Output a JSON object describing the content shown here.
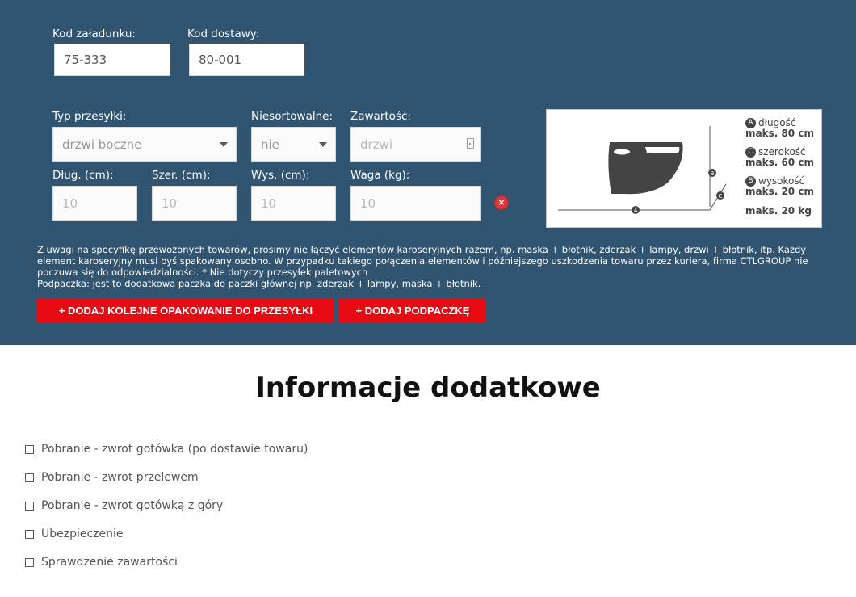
{
  "shipment": {
    "load_code": {
      "label": "Kod załadunku:",
      "value": "75-333"
    },
    "delivery_code": {
      "label": "Kod dostawy:",
      "value": "80-001"
    },
    "type": {
      "label": "Typ przesyłki:",
      "value": "drzwi boczne"
    },
    "unsorted": {
      "label": "Niesortowalne:",
      "value": "nie"
    },
    "contents": {
      "label": "Zawartość:",
      "placeholder": "drzwi"
    },
    "length": {
      "label": "Dług. (cm):",
      "value": "10"
    },
    "width": {
      "label": "Szer. (cm):",
      "value": "10"
    },
    "height": {
      "label": "Wys. (cm):",
      "value": "10"
    },
    "weight": {
      "label": "Waga (kg):",
      "value": "10"
    },
    "remove_label": "×"
  },
  "diagram": {
    "a_letter": "A",
    "a_label": "długość",
    "a_max": "maks. 80 cm",
    "c_letter": "C",
    "c_label": "szerokość",
    "c_max": "maks. 60 cm",
    "b_letter": "B",
    "b_label": "wysokość",
    "b_max": "maks. 20 cm",
    "weight_max": "maks. 20 kg"
  },
  "notice": {
    "line1": "Z uwagi na specyfikę przewożonych towarów, prosimy nie łączyć elementów karoseryjnych razem, np. maska + błotnik, zderzak + lampy, drzwi + błotnik, itp. Każdy element karoseryjny musi byś spakowany osobno. W przypadku takiego połączenia elementów i późniejszego uszkodzenia towaru przez kuriera, firma CTLGROUP nie poczuwa się do odpowiedzialności. * Nie dotyczy przesyłek paletowych",
    "line2": "Podpaczka:  jest  to dodatkowa paczka do paczki głównej np. zderzak +  lampy,  maska + błotnik."
  },
  "buttons": {
    "add_package": "+ DODAJ KOLEJNE OPAKOWANIE DO PRZESYŁKI",
    "add_subpackage": "+ DODAJ PODPACZKĘ"
  },
  "extras": {
    "title": "Informacje dodatkowe",
    "options": [
      "Pobranie - zwrot gotówka (po dostawie towaru)",
      "Pobranie - zwrot przelewem",
      "Pobranie - zwrot gotówką z góry",
      "Ubezpieczenie",
      "Sprawdzenie zawartości"
    ]
  },
  "colors": {
    "panel": "#315470",
    "accent": "#e80a13"
  }
}
